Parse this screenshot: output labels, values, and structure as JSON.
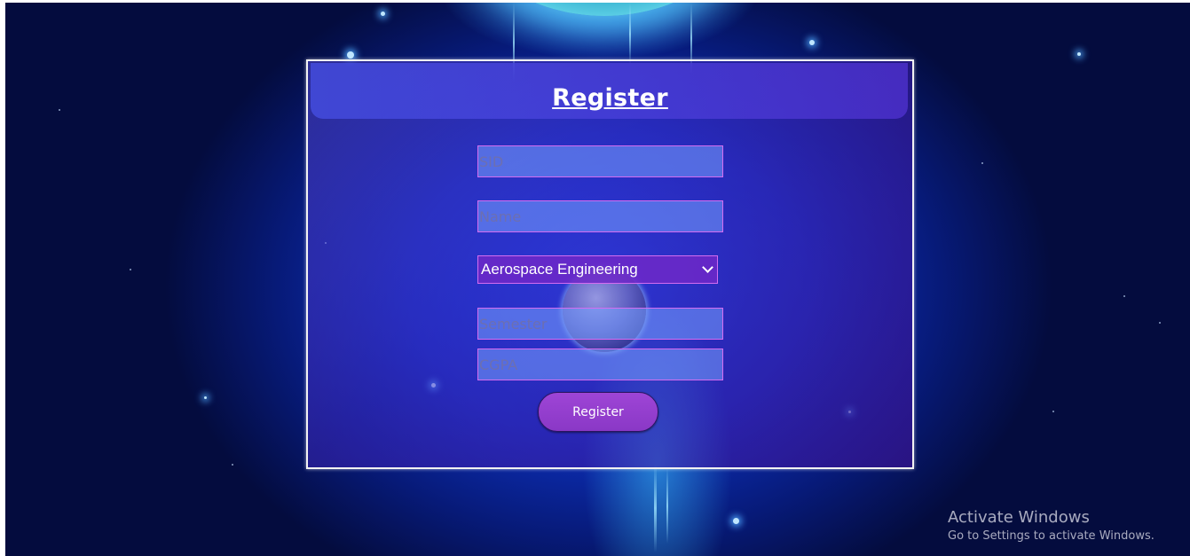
{
  "form": {
    "title": "Register",
    "sid_placeholder": "SID",
    "name_placeholder": "Name",
    "department_selected": "Aerospace Engineering",
    "semester_placeholder": "Semester",
    "cgpa_placeholder": "CGPA",
    "submit_label": "Register"
  },
  "watermark": {
    "title": "Activate Windows",
    "subtitle": "Go to Settings to activate Windows."
  },
  "colors": {
    "accent_button": "#9a42d2",
    "field_border": "#d46cf0",
    "background_deep": "#071a78"
  }
}
